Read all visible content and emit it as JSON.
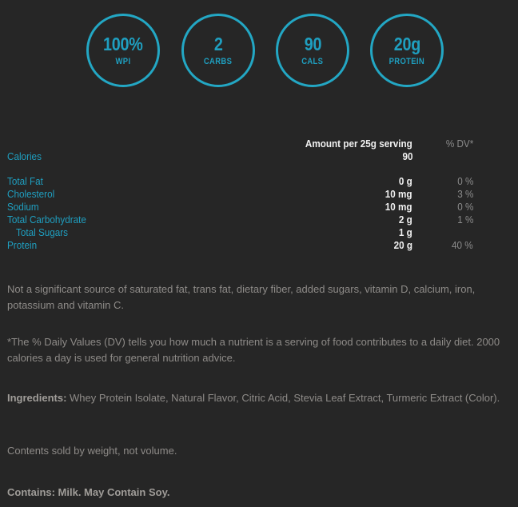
{
  "theme": {
    "background": "#262626",
    "accent": "#1f9fc0",
    "ring": "#23a7c4",
    "value_text": "#f0f0f0",
    "muted_text": "#8c8c8c",
    "body_text": "#8e8b88"
  },
  "highlights": [
    {
      "value": "100%",
      "label": "WPI"
    },
    {
      "value": "2",
      "label": "CARBS"
    },
    {
      "value": "90",
      "label": "CALS"
    },
    {
      "value": "20g",
      "label": "PROTEIN"
    }
  ],
  "nutrition": {
    "header": {
      "amount": "Amount per 25g serving",
      "dv": "% DV*"
    },
    "rows": [
      {
        "label": "Calories",
        "amount": "90",
        "dv": "",
        "indent": false,
        "gap": false
      },
      {
        "label": "Total Fat",
        "amount": "0 g",
        "dv": "0 %",
        "indent": false,
        "gap": true
      },
      {
        "label": "Cholesterol",
        "amount": "10 mg",
        "dv": "3 %",
        "indent": false,
        "gap": false
      },
      {
        "label": "Sodium",
        "amount": "10 mg",
        "dv": "0 %",
        "indent": false,
        "gap": false
      },
      {
        "label": "Total Carbohydrate",
        "amount": "2 g",
        "dv": "1 %",
        "indent": false,
        "gap": false
      },
      {
        "label": "Total Sugars",
        "amount": "1 g",
        "dv": "",
        "indent": true,
        "gap": false
      },
      {
        "label": "Protein",
        "amount": "20 g",
        "dv": "40 %",
        "indent": false,
        "gap": false
      }
    ]
  },
  "notes": {
    "not_significant": "Not a significant source of saturated fat, trans fat, dietary fiber, added sugars, vitamin D, calcium, iron, potassium and vitamin C.",
    "daily_value": "*The % Daily Values (DV) tells you how much a nutrient is a serving of food contributes to a daily diet. 2000 calories a day is used for general nutrition advice.",
    "ingredients_label": "Ingredients:",
    "ingredients_text": " Whey Protein Isolate, Natural Flavor, Citric Acid, Stevia Leaf Extract, Turmeric Extract (Color).",
    "contents": "Contents sold by weight, not volume.",
    "contains": "Contains: Milk. May Contain Soy."
  }
}
